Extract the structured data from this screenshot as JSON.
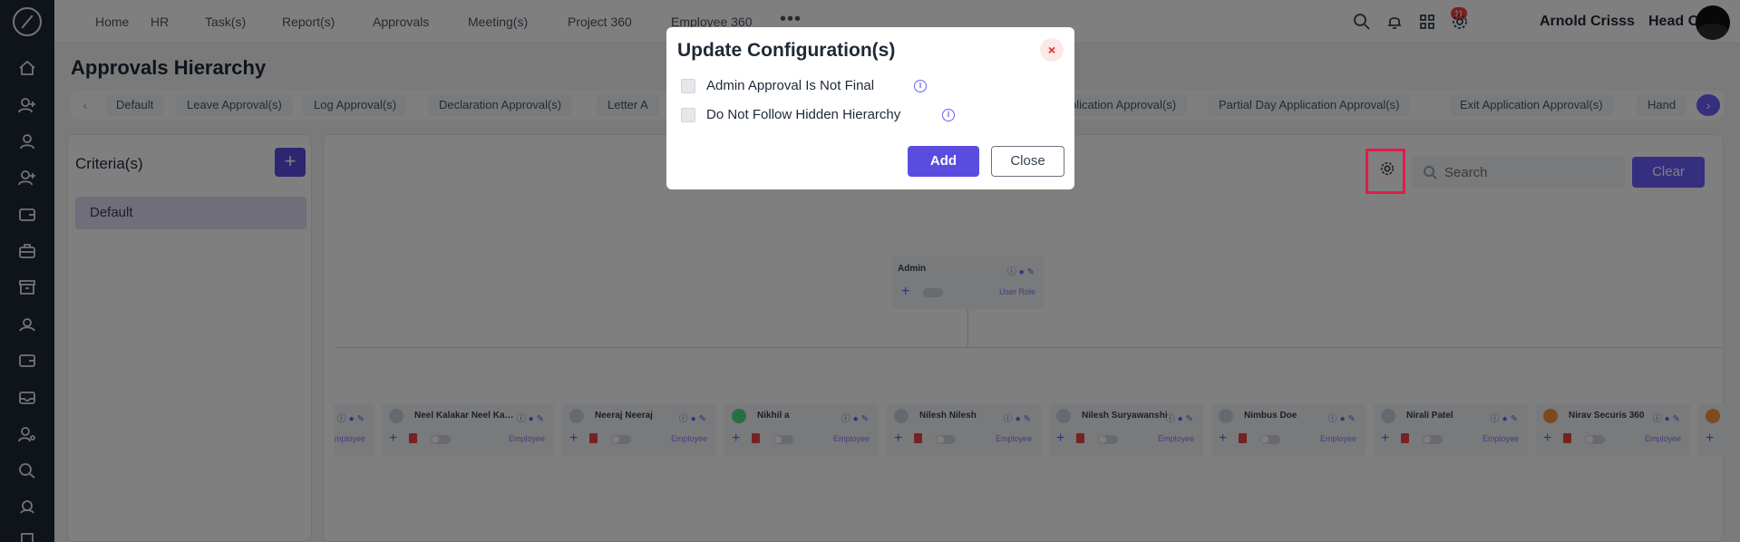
{
  "nav": {
    "items": [
      "Home",
      "HR",
      "Task(s)",
      "Report(s)",
      "Approvals",
      "Meeting(s)",
      "Project 360",
      "Employee 360"
    ],
    "notification_count": "11",
    "user_name": "Arnold Crisss",
    "office": "Head Office"
  },
  "page": {
    "title": "Approvals Hierarchy"
  },
  "tabs": [
    "Default",
    "Leave Approval(s)",
    "Log Approval(s)",
    "Declaration Approval(s)",
    "Letter A",
    "plication Approval(s)",
    "Partial Day Application Approval(s)",
    "Exit Application Approval(s)",
    "Hand"
  ],
  "criteria": {
    "title": "Criteria(s)",
    "add_label": "+",
    "items": [
      "Default"
    ]
  },
  "toolbar": {
    "search_placeholder": "Search",
    "clear_label": "Clear"
  },
  "admin_node": {
    "name": "Admin",
    "role": "User Role",
    "add": "+"
  },
  "nodes": [
    {
      "name": "",
      "role": "mployee",
      "avatar": "grey"
    },
    {
      "name": "Neel Kalakar Neel Kala...",
      "role": "Employee",
      "avatar": "grey"
    },
    {
      "name": "Neeraj Neeraj",
      "role": "Employee",
      "avatar": "grey"
    },
    {
      "name": "Nikhil a",
      "role": "Employee",
      "avatar": "green"
    },
    {
      "name": "Nilesh Nilesh",
      "role": "Employee",
      "avatar": "grey"
    },
    {
      "name": "Nilesh Suryawanshi",
      "role": "Employee",
      "avatar": "grey"
    },
    {
      "name": "Nimbus Doe",
      "role": "Employee",
      "avatar": "grey"
    },
    {
      "name": "Nirali Patel",
      "role": "Employee",
      "avatar": "grey"
    },
    {
      "name": "Nirav Securis 360",
      "role": "Employee",
      "avatar": "orange"
    }
  ],
  "modal": {
    "title": "Update Configuration(s)",
    "close_icon": "×",
    "options": [
      {
        "label": "Admin Approval Is Not Final",
        "checked": false
      },
      {
        "label": "Do Not Follow Hidden Hierarchy",
        "checked": false
      }
    ],
    "add_label": "Add",
    "close_label": "Close"
  },
  "colors": {
    "primary": "#5b4ce0",
    "accent": "#6d5dfc",
    "highlight": "#e11d48"
  }
}
